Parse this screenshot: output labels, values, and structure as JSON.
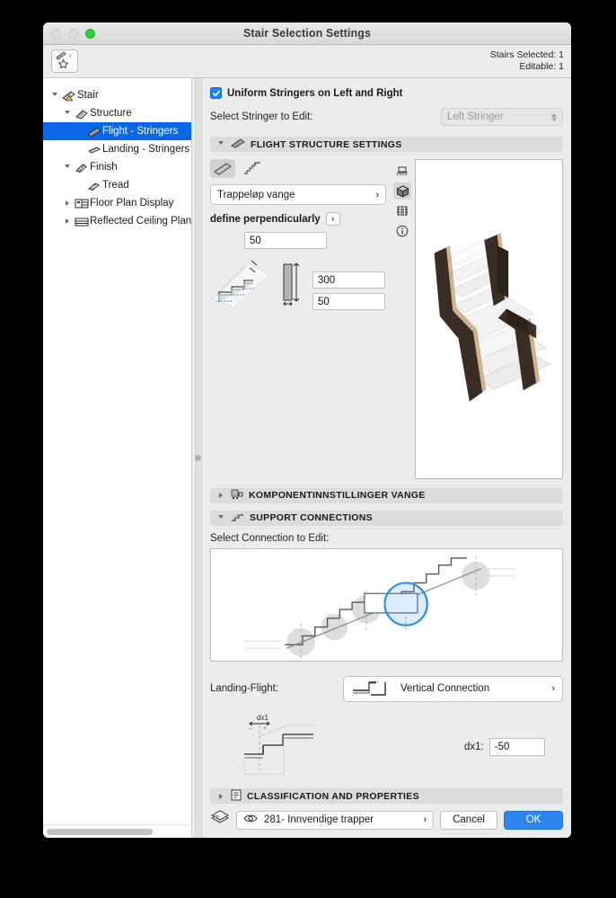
{
  "window": {
    "title": "Stair Selection Settings",
    "traffic_lights": [
      "close-disabled",
      "minimize-disabled",
      "zoom-green"
    ]
  },
  "toolbar": {
    "favorites_icon": "stringer-favorites-icon",
    "stairs_selected": "Stairs Selected: 1",
    "editable": "Editable: 1"
  },
  "sidebar": {
    "items": [
      {
        "label": "Stair",
        "icon": "stair-warning-icon",
        "depth": 0,
        "twisty": "open",
        "selected": false
      },
      {
        "label": "Structure",
        "icon": "structure-icon",
        "depth": 1,
        "twisty": "open",
        "selected": false
      },
      {
        "label": "Flight - Stringers",
        "icon": "flight-stringers-icon",
        "depth": 2,
        "twisty": "none",
        "selected": true
      },
      {
        "label": "Landing - Stringers",
        "icon": "landing-stringers-icon",
        "depth": 2,
        "twisty": "none",
        "selected": false
      },
      {
        "label": "Finish",
        "icon": "finish-icon",
        "depth": 1,
        "twisty": "open",
        "selected": false
      },
      {
        "label": "Tread",
        "icon": "tread-icon",
        "depth": 2,
        "twisty": "none",
        "selected": false
      },
      {
        "label": "Floor Plan Display",
        "icon": "floor-plan-display-icon",
        "depth": 1,
        "twisty": "closed",
        "selected": false
      },
      {
        "label": "Reflected Ceiling Plan D",
        "icon": "reflected-ceiling-icon",
        "depth": 1,
        "twisty": "closed",
        "selected": false
      }
    ]
  },
  "main": {
    "uniform_stringers": {
      "label": "Uniform Stringers on Left and Right",
      "checked": true
    },
    "select_stringer": {
      "label": "Select Stringer to Edit:",
      "value": "Left Stringer",
      "disabled": true
    },
    "flight_structure": {
      "header": "FLIGHT STRUCTURE SETTINGS",
      "header_icon": "flight-stringers-icon",
      "expanded": true,
      "toggles": [
        {
          "name": "monolithic-stringer-toggle",
          "active": true
        },
        {
          "name": "stepped-stringer-toggle",
          "active": false
        }
      ],
      "structure_type": "Trappeløp vange",
      "define_label": "define perpendicularly",
      "offset_value": "50",
      "width_value": "300",
      "thickness_value": "50"
    },
    "preview": {
      "view_icons": [
        {
          "name": "section-view-icon",
          "active": false
        },
        {
          "name": "3d-view-icon",
          "active": true
        },
        {
          "name": "elevation-view-icon",
          "active": false
        },
        {
          "name": "info-view-icon",
          "active": false
        }
      ],
      "model": "stair-3d-preview",
      "colors": {
        "stringer": "#3a2d26",
        "stringer_edge": "#c9a67f",
        "tread": "#f2f2f2",
        "tread_shade": "#dcdcdc"
      }
    },
    "component_settings": {
      "header": "KOMPONENTINNSTILLINGER VANGE",
      "header_icon": "component-settings-icon",
      "expanded": false
    },
    "support_connections": {
      "header": "SUPPORT CONNECTIONS",
      "header_icon": "support-connections-icon",
      "expanded": true,
      "select_label": "Select Connection to Edit:",
      "diagram": "stair-section-connections-diagram",
      "nodes": [
        {
          "name": "connection-node-1",
          "selected": false
        },
        {
          "name": "connection-node-2",
          "selected": false
        },
        {
          "name": "connection-node-3",
          "selected": false
        },
        {
          "name": "connection-node-4",
          "selected": true
        },
        {
          "name": "connection-node-5",
          "selected": false
        }
      ],
      "selection_color": "#3a9cf0",
      "landing_flight_label": "Landing-Flight:",
      "landing_flight_value": "Vertical Connection",
      "landing_flight_icon": "vertical-connection-icon",
      "dx1_label": "dx1:",
      "dx1_value": "-50",
      "dx1_diagram": "dx1-offset-diagram",
      "dx1_diagram_label": "dx1"
    },
    "classification": {
      "header": "CLASSIFICATION AND PROPERTIES",
      "header_icon": "classification-icon",
      "expanded": false
    }
  },
  "footer": {
    "layers_icon": "layers-icon",
    "eye_icon": "eye-icon",
    "layer_value": "281- Innvendige trapper",
    "cancel_label": "Cancel",
    "ok_label": "OK",
    "accent_color": "#2f84f0"
  }
}
